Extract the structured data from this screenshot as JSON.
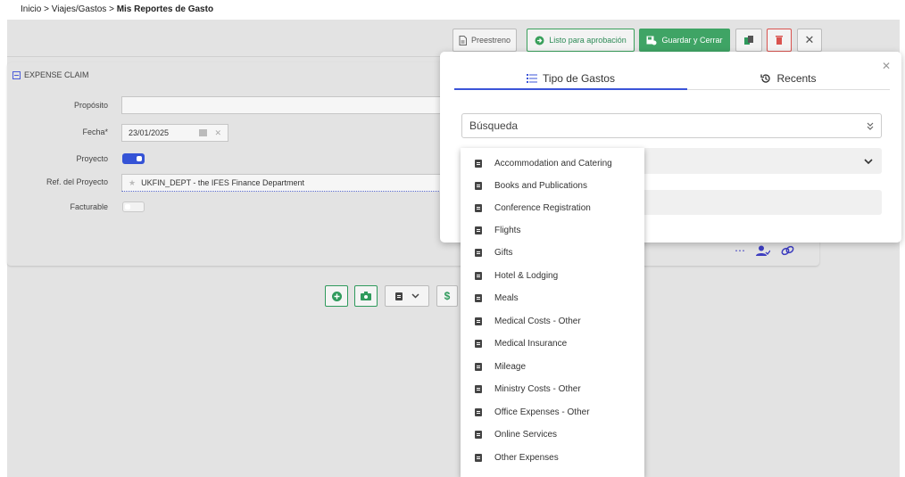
{
  "breadcrumb": {
    "home": "Inicio",
    "sep1": ">",
    "section": "Viajes/Gastos",
    "sep2": ">",
    "current": "Mis Reportes de Gasto"
  },
  "toolbar": {
    "preview_label": "Preestreno",
    "ready_label": "Listo para aprobación",
    "save_label": "Guardar y Cerrar",
    "close_symbol": "✕"
  },
  "section_title": "EXPENSE CLAIM",
  "form": {
    "purpose_label": "Propósito",
    "purpose_value": "",
    "date_label": "Fecha*",
    "date_value": "23/01/2025",
    "project_label": "Proyecto",
    "project_ref_label": "Ref. del Proyecto",
    "project_ref_value": "UKFIN_DEPT - the IFES Finance Department",
    "billable_label": "Facturable"
  },
  "modal": {
    "tab_types": "Tipo de Gastos",
    "tab_recents": "Recents",
    "search_placeholder": "Búsqueda"
  },
  "expense_types": [
    "Accommodation and Catering",
    "Books and Publications",
    "Conference Registration",
    "Flights",
    "Gifts",
    "Hotel & Lodging",
    "Meals",
    "Medical Costs - Other",
    "Medical Insurance",
    "Mileage",
    "Ministry Costs - Other",
    "Office Expenses - Other",
    "Online Services",
    "Other Expenses"
  ],
  "colors": {
    "accent": "#3b54d8",
    "green": "#3fa465",
    "danger": "#d9534f"
  }
}
